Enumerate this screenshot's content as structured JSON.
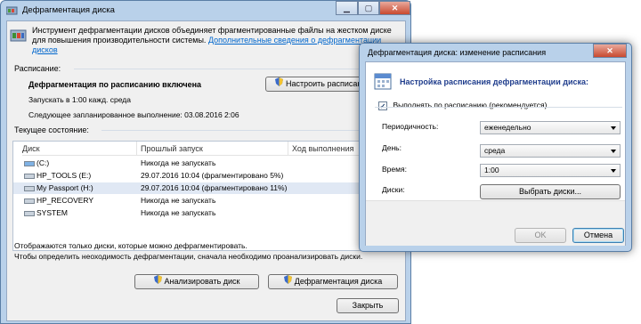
{
  "main": {
    "title": "Дефрагментация диска",
    "intro": "Инструмент дефрагментации дисков объединяет фрагментированные файлы на жестком диске для повышения производительности системы.",
    "more_link": "Дополнительные сведения о дефрагментации дисков",
    "schedule_label": "Расписание:",
    "schedule_status": "Дефрагментация по расписанию включена",
    "schedule_run": "Запускать в 1:00 кажд. среда",
    "schedule_next": "Следующее запланированное выполнение: 03.08.2016 2:06",
    "configure_button": "Настроить расписание...",
    "current_state_label": "Текущее состояние:",
    "columns": [
      "Диск",
      "Прошлый запуск",
      "Ход выполнения"
    ],
    "drives": [
      {
        "name": "(C:)",
        "last": "Никогда не запускать"
      },
      {
        "name": "HP_TOOLS (E:)",
        "last": "29.07.2016 10:04 (фрагментировано 5%)"
      },
      {
        "name": "My Passport (H:)",
        "last": "29.07.2016 10:04 (фрагментировано 11%)"
      },
      {
        "name": "HP_RECOVERY",
        "last": "Никогда не запускать"
      },
      {
        "name": "SYSTEM",
        "last": "Никогда не запускать"
      }
    ],
    "note1": "Отображаются только диски, которые можно дефрагментировать.",
    "note2": "Чтобы определить неоходимость дефрагментации, сначала необходимо проанализировать диски.",
    "analyze_button": "Анализировать диск",
    "defrag_button": "Дефрагментация диска",
    "close_button": "Закрыть"
  },
  "dialog": {
    "title": "Дефрагментация диска: изменение расписания",
    "heading": "Настройка расписания дефрагментации диска:",
    "run_on_schedule": "Выполнять по расписанию (рекомендуется)",
    "run_on_schedule_checked": true,
    "frequency_label": "Периодичность:",
    "frequency_value": "еженедельно",
    "day_label": "День:",
    "day_value": "среда",
    "time_label": "Время:",
    "time_value": "1:00",
    "disks_label": "Диски:",
    "select_disks_button": "Выбрать диски...",
    "ok_button": "OK",
    "cancel_button": "Отмена"
  },
  "colors": {
    "accent": "#1e3c8c",
    "link": "#0066cc",
    "frame": "#b9d1ea"
  }
}
